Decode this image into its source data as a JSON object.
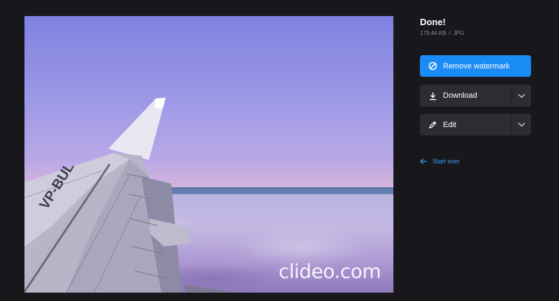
{
  "preview": {
    "watermark": "clideo.com"
  },
  "result": {
    "title": "Done!",
    "file_size": "179.44 KB",
    "separator": "/",
    "file_type": "JPG"
  },
  "actions": {
    "remove_watermark_label": "Remove watermark",
    "download_label": "Download",
    "edit_label": "Edit",
    "start_over_label": "Start over"
  },
  "icons": {
    "remove_watermark": "no-entry-icon",
    "download": "download-icon",
    "edit": "pencil-icon",
    "dropdown": "chevron-down-icon",
    "start_over": "arrow-left-icon"
  },
  "colors": {
    "background": "#17171c",
    "primary": "#1b8cf5",
    "button_dark": "#2c2c33",
    "link": "#3e9cf6",
    "muted_text": "#8f8f99"
  }
}
